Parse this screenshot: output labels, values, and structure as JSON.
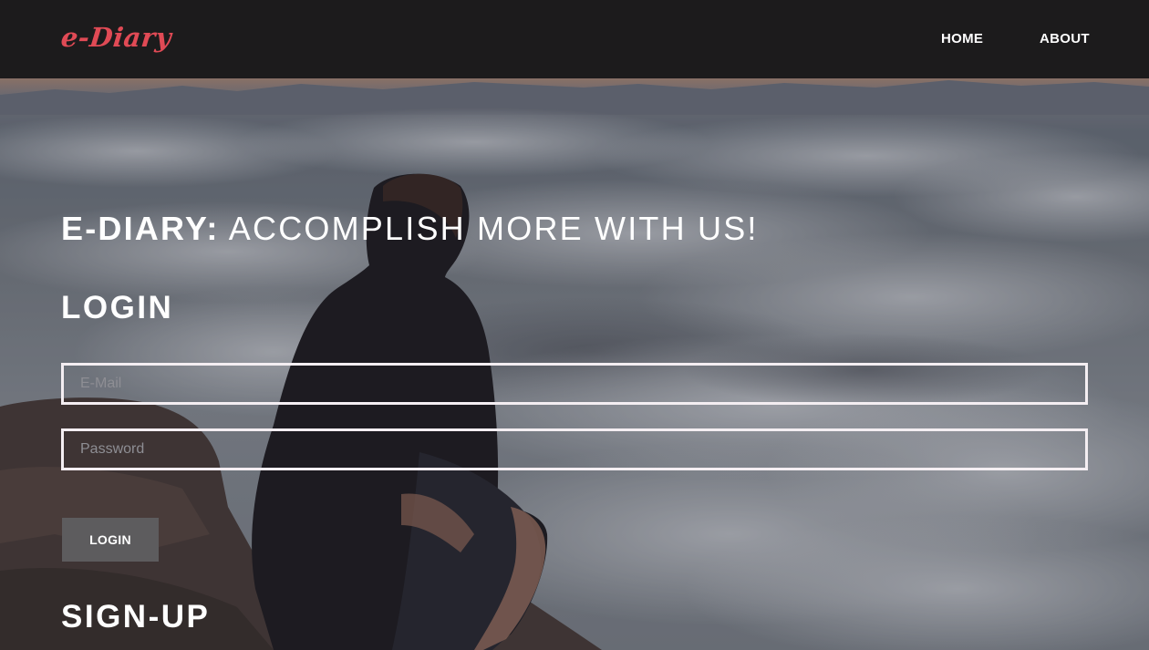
{
  "navbar": {
    "brand": "e-Diary",
    "links": [
      {
        "label": "HOME"
      },
      {
        "label": "ABOUT"
      }
    ]
  },
  "hero": {
    "tagline_bold": "E-DIARY:",
    "tagline_rest": " ACCOMPLISH MORE WITH US!"
  },
  "login": {
    "heading": "LOGIN",
    "email_placeholder": "E-Mail",
    "email_value": "",
    "password_placeholder": "Password",
    "password_value": "",
    "button_label": "LOGIN"
  },
  "signup": {
    "heading": "SIGN-UP"
  },
  "colors": {
    "navbar_bg": "#1c1b1c",
    "brand": "#e04a55",
    "button_bg": "#5d5c5e",
    "field_border": "#f4eef2"
  }
}
